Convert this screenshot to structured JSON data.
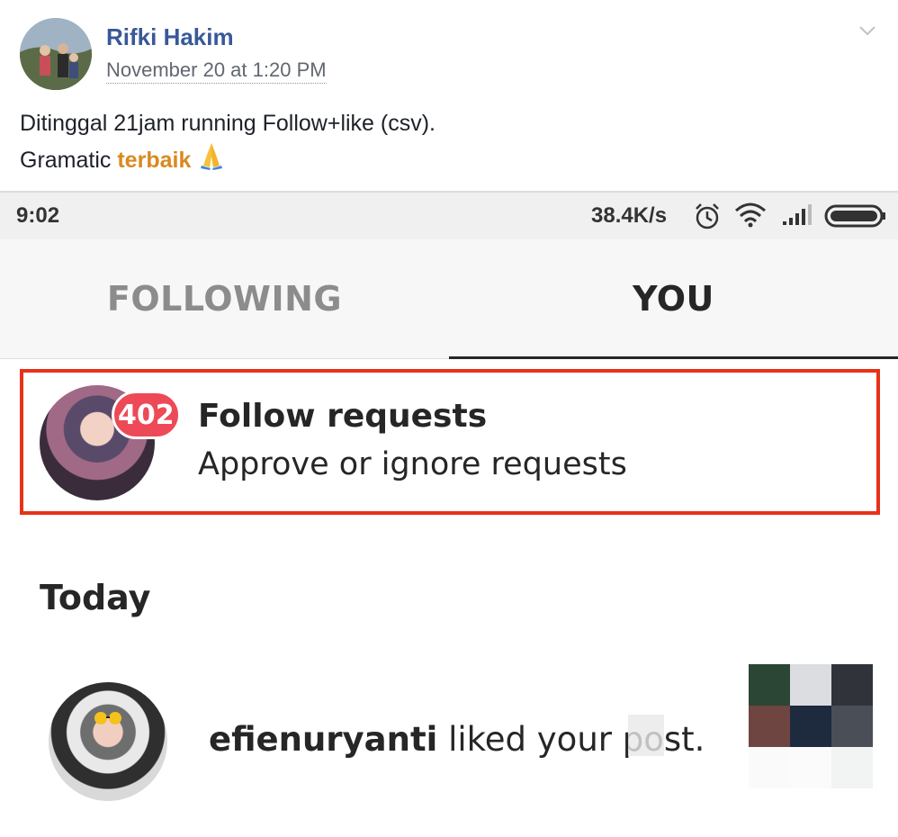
{
  "post": {
    "author": "Rifki Hakim",
    "timestamp": "November 20 at 1:20 PM",
    "line1": "Ditinggal 21jam running Follow+like (csv).",
    "line2_prefix": "Gramatic ",
    "line2_highlight": "terbaik",
    "emoji": "🙏",
    "menu_icon": "chevron-down-icon"
  },
  "status_bar": {
    "time": "9:02",
    "speed": "38.4K/s",
    "icons": [
      "alarm-icon",
      "wifi-icon",
      "signal-icon",
      "battery-icon"
    ]
  },
  "tabs": [
    {
      "label": "FOLLOWING",
      "active": false
    },
    {
      "label": "YOU",
      "active": true
    }
  ],
  "follow_requests": {
    "badge": "402",
    "title": "Follow requests",
    "subtitle": "Approve or ignore requests",
    "highlight_color": "#e8311a"
  },
  "section": {
    "title": "Today"
  },
  "activity": [
    {
      "username": "efienuryanti",
      "action": " liked your post."
    }
  ],
  "colors": {
    "author_link": "#385898",
    "highlight_text": "#d98a1f",
    "badge_red": "#ed4956"
  }
}
